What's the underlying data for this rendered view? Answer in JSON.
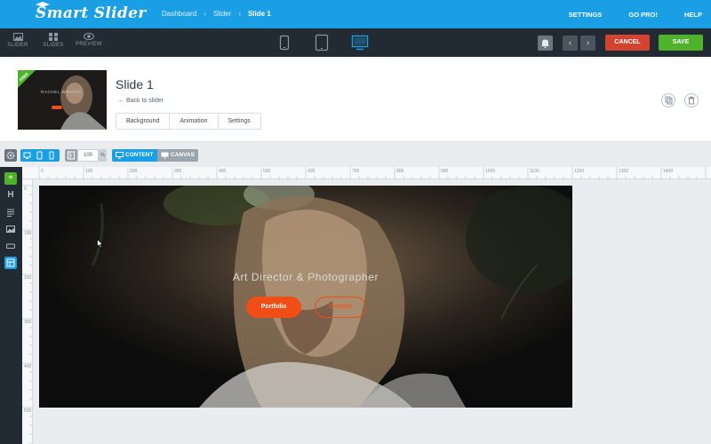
{
  "app": {
    "logo_text": "Smart Slider"
  },
  "breadcrumb": {
    "items": [
      "Dashboard",
      "Slider",
      "Slide 1"
    ]
  },
  "topnav": {
    "settings": "SETTINGS",
    "gopro": "GO PRO!",
    "help": "HELP"
  },
  "toolbar": {
    "slider_label": "SLIDER",
    "slides_label": "SLIDES",
    "preview_label": "PREVIEW",
    "cancel_label": "CANCEL",
    "save_label": "SAVE"
  },
  "slide": {
    "title": "Slide 1",
    "back_label": "Back to slider",
    "thumb_badge": "FREE",
    "thumb_name": "RACHEL WRIGHT",
    "tabs": [
      "Background",
      "Animation",
      "Settings"
    ]
  },
  "subbar": {
    "zoom_value": "100",
    "zoom_unit": "%",
    "content_label": "CONTENT",
    "canvas_label": "CANVAS"
  },
  "ruler": {
    "x": [
      "0",
      "100",
      "200",
      "300",
      "400",
      "500",
      "600",
      "700",
      "800",
      "900",
      "1000",
      "1100",
      "1200",
      "1300",
      "1400"
    ],
    "y": [
      "0",
      "100",
      "200",
      "300",
      "400",
      "500"
    ]
  },
  "canvas": {
    "caption": "Art Director & Photographer",
    "portfolio_label": "Portfolio",
    "contact_label": "Contact"
  },
  "colors": {
    "brand": "#1a9ee4",
    "toolbar": "#222b33",
    "cancel": "#d4432f",
    "save": "#4eb32b",
    "accent": "#f04e16"
  }
}
